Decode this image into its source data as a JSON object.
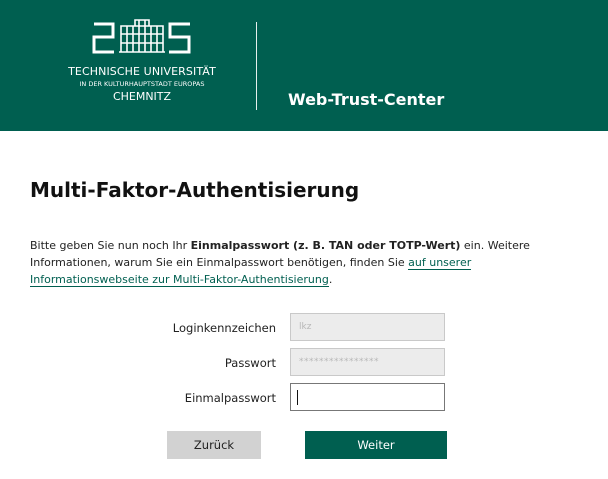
{
  "header": {
    "logo": {
      "line1": "TECHNISCHE UNIVERSITÄT",
      "line2": "IN DER KULTURHAUPTSTADT EUROPAS",
      "line3": "CHEMNITZ"
    },
    "site_title": "Web-Trust-Center"
  },
  "main": {
    "title": "Multi-Faktor-Authentisierung",
    "intro": {
      "part1": "Bitte geben Sie nun noch Ihr ",
      "bold": "Einmalpasswort (z. B. TAN oder TOTP-Wert)",
      "part2": " ein. Weitere Informationen, warum Sie ein Einmalpasswort benötigen, finden Sie ",
      "link": "auf unserer Informationswebseite zur Multi-Faktor-Authentisierung",
      "part3": "."
    },
    "form": {
      "login_label": "Loginkennzeichen",
      "login_value": "lkz",
      "password_label": "Passwort",
      "password_value": "****************",
      "otp_label": "Einmalpasswort",
      "otp_value": ""
    },
    "buttons": {
      "back": "Zurück",
      "next": "Weiter"
    }
  },
  "colors": {
    "brand": "#005f50",
    "back_button": "#d2d2d2"
  }
}
